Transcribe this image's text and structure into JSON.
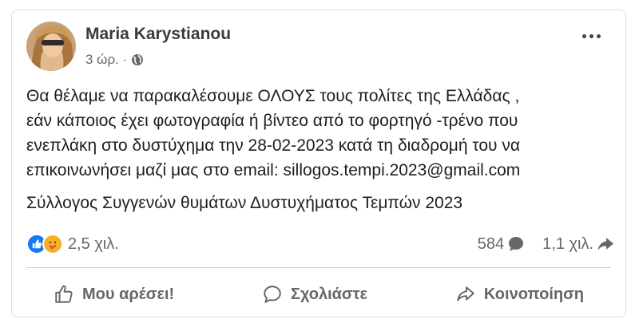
{
  "post": {
    "author": "Maria Karystianou",
    "time": "3 ώρ. ·",
    "audience_icon": "globe-icon",
    "body_lines": [
      "Θα θέλαμε να παρακαλέσουμε ΟΛΟΥΣ τους πολίτες της Ελλάδας ,",
      "εάν κάποιος έχει φωτογραφία ή βίντεο από το φορτηγό -τρένο που",
      "ενεπλάκη στο δυστύχημα την 28-02-2023 κατά τη διαδρομή του να",
      "επικοινωνήσει μαζί μας στο email: sillogos.tempi.2023@gmail.com"
    ],
    "signature": "Σύλλογος Συγγενών θυμάτων Δυστυχήματος Τεμπών 2023"
  },
  "stats": {
    "reactions_count": "2,5 χιλ.",
    "reaction_icons": [
      "like-icon",
      "care-icon"
    ],
    "comments_count": "584",
    "shares_count": "1,1 χιλ."
  },
  "actions": {
    "like": "Μου αρέσει!",
    "comment": "Σχολιάστε",
    "share": "Κοινοποίηση"
  },
  "colors": {
    "like_blue": "#1877f2",
    "care_yellow": "#f7b125",
    "muted_text": "#65676b",
    "divider": "#ced0d4"
  }
}
